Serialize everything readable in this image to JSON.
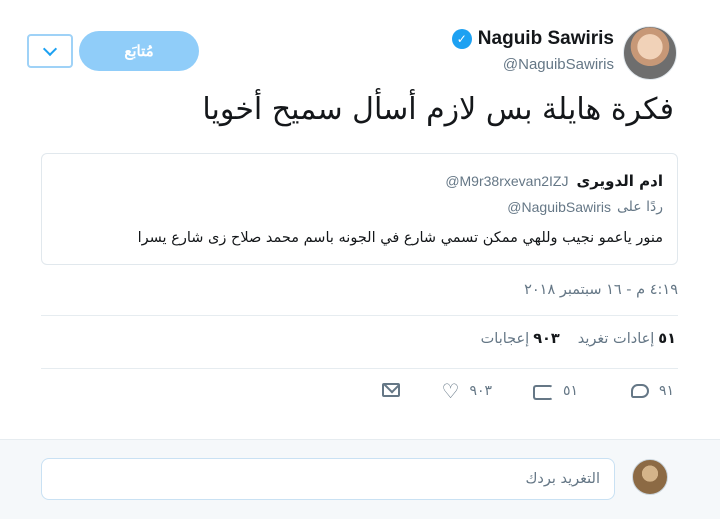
{
  "author": {
    "name": "Naguib Sawiris",
    "handle": "@NaguibSawiris"
  },
  "follow_button": {
    "label": "مُتابَع"
  },
  "tweet": {
    "text": "فكرة هايلة بس لازم أسأل سميح أخويا",
    "timestamp": "٤:١٩ م - ١٦ سبتمبر ٢٠١٨"
  },
  "quoted_tweet": {
    "name": "ادم الدويرى",
    "handle": "@M9r38rxevan2IZJ",
    "reply_prefix": "ردًا على",
    "reply_to": "@NaguibSawiris",
    "text": "منور ياعمو نجيب وللهي ممكن تسمي شارع في الجونه باسم محمد صلاح زى شارع يسرا"
  },
  "stats": {
    "retweets_count": "٥١",
    "retweets_label": "إعادات تغريد",
    "likes_count": "٩٠٣",
    "likes_label": "إعجابات"
  },
  "actions": {
    "reply_count": "٩١",
    "retweet_count": "٥١",
    "like_count": "٩٠٣"
  },
  "reply_box": {
    "placeholder": "التغريد بردك"
  },
  "colors": {
    "accent": "#1da1f2",
    "follow_bg": "#90cdf9",
    "muted": "#657786"
  },
  "icons": [
    "verified-icon",
    "chevron-down-icon",
    "reply-icon",
    "retweet-icon",
    "like-icon",
    "message-icon"
  ]
}
